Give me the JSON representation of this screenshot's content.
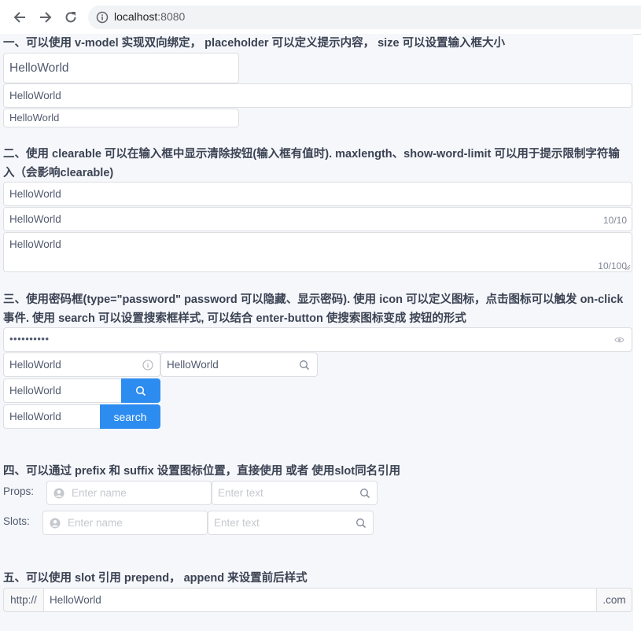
{
  "browser": {
    "url_host": "localhost",
    "url_port": ":8080"
  },
  "sections": {
    "s1": {
      "heading": "一、可以使用 v-model 实现双向绑定， placeholder 可以定义提示内容， size 可以设置输入框大小"
    },
    "s2": {
      "heading": "二、使用 clearable 可以在输入框中显示清除按钮(输入框有值时). maxlength、show-word-limit 可以用于提示限制字符输入（会影响clearable)"
    },
    "s3": {
      "heading": "三、使用密码框(type=\"password\" password 可以隐藏、显示密码). 使用 icon 可以定义图标，点击图标可以触发 on-click 事件. 使用 search 可以设置搜索框样式, 可以结合 enter-button 使搜索图标变成 按钮的形式"
    },
    "s4": {
      "heading": "四、可以通过 prefix 和 suffix 设置图标位置，直接使用 或者 使用slot同名引用"
    },
    "s5": {
      "heading": "五、可以使用 slot 引用 prepend， append 来设置前后样式"
    }
  },
  "inputs": {
    "large": "HelloWorld",
    "default": "HelloWorld",
    "small": "HelloWorld",
    "clearable": "HelloWorld",
    "maxlength": "HelloWorld",
    "maxlength_count": "10/10",
    "textarea": "HelloWorld",
    "textarea_count": "10/100",
    "password": "••••••••••",
    "icon_input": "HelloWorld",
    "search_input": "HelloWorld",
    "search_btn_input": "HelloWorld",
    "search_text_input": "HelloWorld",
    "search_button_label": "search"
  },
  "affix": {
    "props_label": "Props:",
    "slots_label": "Slots:",
    "name_placeholder": "Enter name",
    "text_placeholder": "Enter text"
  },
  "addon": {
    "prepend": "http://",
    "value": "HelloWorld",
    "append": ".com"
  },
  "colors": {
    "primary": "#2d8cf0",
    "border": "#dcdee2",
    "page_bg": "#f5f7fb"
  }
}
